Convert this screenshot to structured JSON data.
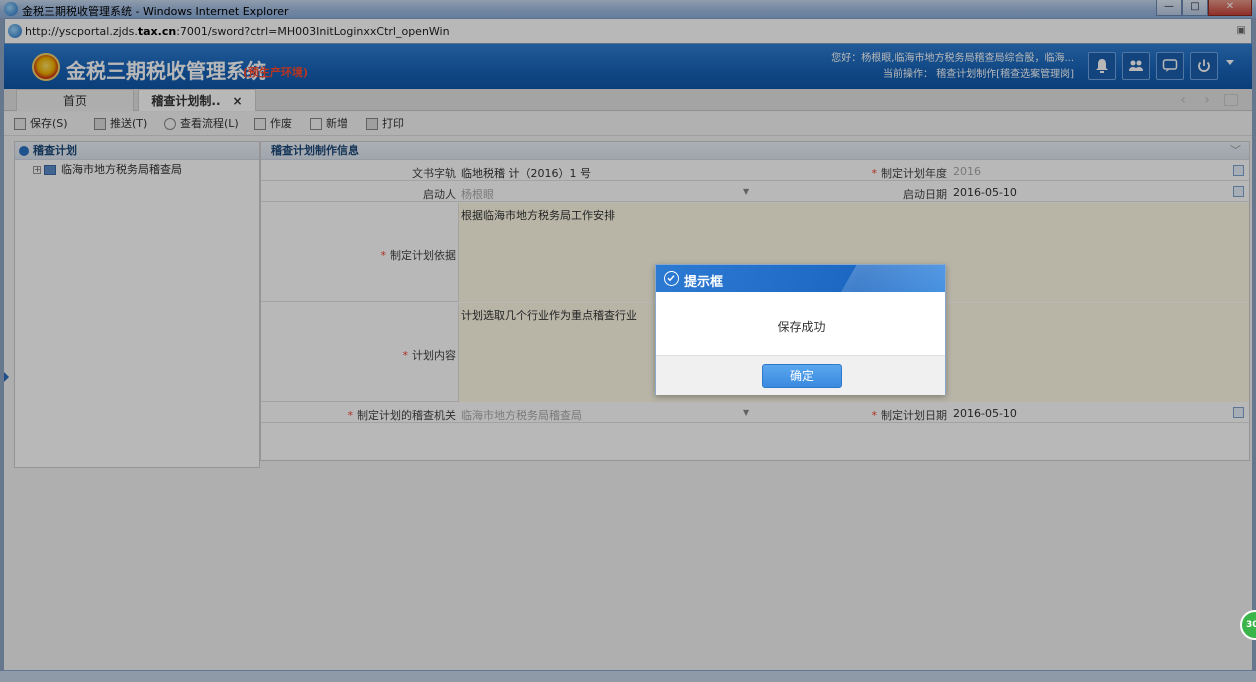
{
  "window": {
    "title": "金税三期税收管理系统 - Windows Internet Explorer",
    "controls": {
      "min": "—",
      "max": "□",
      "close": "✕"
    }
  },
  "addressbar": {
    "url_prefix": "http://yscportal.zjds.",
    "url_domain": "tax.cn",
    "url_suffix": ":7001/sword?ctrl=MH003InitLoginxxCtrl_openWin"
  },
  "header": {
    "title": "金税三期税收管理系统",
    "env": "(预生产环境)",
    "greeting": "您好：杨根眼,临海市地方税务局稽查局综合股，临海...",
    "current_op": "当前操作： 稽查计划制作[稽查选案管理岗]"
  },
  "tabs": [
    {
      "label": "首页"
    },
    {
      "label": "稽查计划制..",
      "close": "×"
    }
  ],
  "tab_nav": {
    "prev": "‹",
    "next": "›"
  },
  "toolbar": {
    "save": "保存(S)",
    "push": "推送(T)",
    "view_flow": "查看流程(L)",
    "void": "作废",
    "new": "新增",
    "print": "打印"
  },
  "left_panel": {
    "title": "稽查计划",
    "tree_item": "临海市地方税务局稽查局",
    "tree_plus": "+"
  },
  "main_panel": {
    "title": "稽查计划制作信息",
    "fields": {
      "doc_no_label": "文书字轨",
      "doc_no_value": "临地税稽 计（2016）1 号",
      "plan_year_label": "制定计划年度",
      "plan_year_value": "2016",
      "initiator_label": "启动人",
      "initiator_value": "杨根眼",
      "start_date_label": "启动日期",
      "start_date_value": "2016-05-10",
      "basis_label": "制定计划依据",
      "basis_value": "根据临海市地方税务局工作安排",
      "content_label": "计划内容",
      "content_value": "计划选取几个行业作为重点稽查行业",
      "org_label": "制定计划的稽查机关",
      "org_value": "临海市地方税务局稽查局",
      "plan_date_label": "制定计划日期",
      "plan_date_value": "2016-05-10"
    },
    "required_mark": "*"
  },
  "modal": {
    "title": "提示框",
    "message": "保存成功",
    "ok": "确定"
  },
  "side_badge": "30"
}
